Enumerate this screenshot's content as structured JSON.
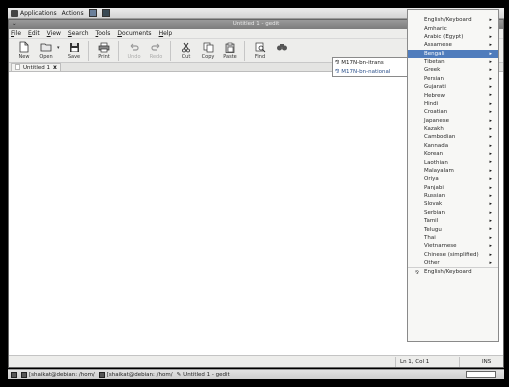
{
  "top_panel": {
    "applications_label": "Applications",
    "actions_label": "Actions"
  },
  "window": {
    "title": "Untitled 1 - gedit"
  },
  "menubar": [
    "File",
    "Edit",
    "View",
    "Search",
    "Tools",
    "Documents",
    "Help"
  ],
  "toolbar": {
    "new_label": "New",
    "open_label": "Open",
    "save_label": "Save",
    "print_label": "Print",
    "undo_label": "Undo",
    "redo_label": "Redo",
    "cut_label": "Cut",
    "copy_label": "Copy",
    "paste_label": "Paste",
    "find_label": "Find"
  },
  "tab": {
    "label": "Untitled 1",
    "close": "x"
  },
  "im_popup": {
    "items": [
      "M17N-bn-itrans",
      "M17N-bn-national"
    ]
  },
  "im_menu": {
    "items": [
      {
        "label": "English/Keyboard",
        "arrow": true
      },
      {
        "label": "Amharic",
        "arrow": true
      },
      {
        "label": "Arabic (Egypt)",
        "arrow": true
      },
      {
        "label": "Assamese",
        "arrow": true
      },
      {
        "label": "Bengali",
        "arrow": true,
        "highlighted": true
      },
      {
        "label": "Tibetan",
        "arrow": true
      },
      {
        "label": "Greek",
        "arrow": true
      },
      {
        "label": "Persian",
        "arrow": true
      },
      {
        "label": "Gujarati",
        "arrow": true
      },
      {
        "label": "Hebrew",
        "arrow": true
      },
      {
        "label": "Hindi",
        "arrow": true
      },
      {
        "label": "Croatian",
        "arrow": true
      },
      {
        "label": "Japanese",
        "arrow": true
      },
      {
        "label": "Kazakh",
        "arrow": true
      },
      {
        "label": "Cambodian",
        "arrow": true
      },
      {
        "label": "Kannada",
        "arrow": true
      },
      {
        "label": "Korean",
        "arrow": true
      },
      {
        "label": "Laothian",
        "arrow": true
      },
      {
        "label": "Malayalam",
        "arrow": true
      },
      {
        "label": "Oriya",
        "arrow": true
      },
      {
        "label": "Panjabi",
        "arrow": true
      },
      {
        "label": "Russian",
        "arrow": true
      },
      {
        "label": "Slovak",
        "arrow": true
      },
      {
        "label": "Serbian",
        "arrow": true
      },
      {
        "label": "Tamil",
        "arrow": true
      },
      {
        "label": "Telugu",
        "arrow": true
      },
      {
        "label": "Thai",
        "arrow": true
      },
      {
        "label": "Vietnamese",
        "arrow": true
      },
      {
        "label": "Chinese (simplified)",
        "arrow": true
      },
      {
        "label": "Other",
        "arrow": true
      },
      {
        "label": "English/Keyboard",
        "arrow": false,
        "kb_icon": true
      }
    ]
  },
  "statusbar": {
    "position": "Ln 1, Col 1",
    "mode": "INS"
  },
  "bottom_panel": {
    "tasks": [
      "[shaikat@debian: /hom/",
      "[shaikat@debian: /hom/",
      "Untitled 1 - gedit"
    ]
  },
  "colors": {
    "menu_highlight": "#4f7cbc",
    "titlebar": "#8a8a8a"
  }
}
